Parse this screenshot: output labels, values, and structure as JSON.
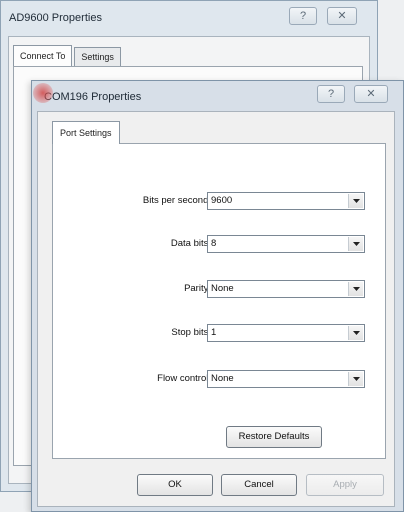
{
  "back_window": {
    "title": "AD9600 Properties",
    "help_glyph": "?",
    "close_glyph": "✕",
    "tabs": [
      {
        "label": "Connect To"
      },
      {
        "label": "Settings"
      }
    ]
  },
  "front_window": {
    "title": "COM196 Properties",
    "help_glyph": "?",
    "close_glyph": "✕",
    "tab": {
      "label": "Port Settings"
    },
    "fields": [
      {
        "label": "Bits per second:",
        "value": "9600"
      },
      {
        "label": "Data bits:",
        "value": "8"
      },
      {
        "label": "Parity:",
        "value": "None"
      },
      {
        "label": "Stop bits:",
        "value": "1"
      },
      {
        "label": "Flow control:",
        "value": "None"
      }
    ],
    "restore_label": "Restore Defaults",
    "ok_label": "OK",
    "cancel_label": "Cancel",
    "apply_label": "Apply"
  },
  "colors": {
    "accent_dot": "#d24646",
    "window_frame": "#d7dfe8"
  }
}
